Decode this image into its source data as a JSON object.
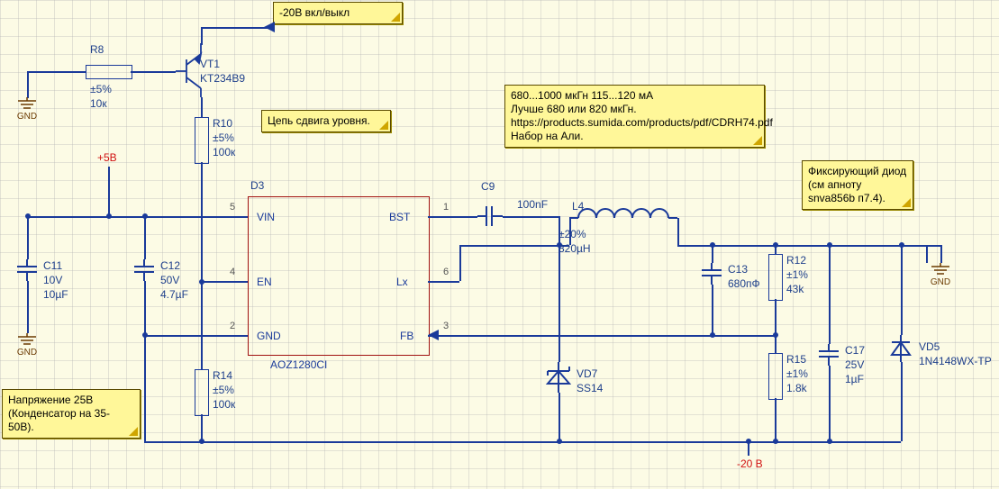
{
  "notes": {
    "input_flag": "-20В вкл/выкл",
    "level_shift": "Цепь сдвига уровня.",
    "inductor": "680...1000 мкГн  115...120 мА\nЛучше 680 или 820 мкГн.\nhttps://products.sumida.com/products/pdf/CDRH74.pdf\nНабор на Али.",
    "clamp_diode": "Фиксирующий диод (см апноту snva856b п7.4).",
    "cap_voltage": "Напряжение 25В (Конденсатор на 35-50B)."
  },
  "nets": {
    "plus5": "+5B",
    "minus20": "-20 B",
    "gnd": "GND"
  },
  "ic": {
    "ref": "D3",
    "part": "AOZ1280CI",
    "pins": {
      "vin": {
        "num": "5",
        "label": "VIN"
      },
      "en": {
        "num": "4",
        "label": "EN"
      },
      "gnd": {
        "num": "2",
        "label": "GND"
      },
      "bst": {
        "num": "1",
        "label": "BST"
      },
      "lx": {
        "num": "6",
        "label": "Lx"
      },
      "fb": {
        "num": "3",
        "label": "FB"
      }
    }
  },
  "parts": {
    "R8": {
      "ref": "R8",
      "tol": "±5%",
      "val": "10к"
    },
    "R10": {
      "ref": "R10",
      "tol": "±5%",
      "val": "100к"
    },
    "R14": {
      "ref": "R14",
      "tol": "±5%",
      "val": "100к"
    },
    "R12": {
      "ref": "R12",
      "tol": "±1%",
      "val": "43k"
    },
    "R15": {
      "ref": "R15",
      "tol": "±1%",
      "val": "1.8k"
    },
    "C9": {
      "ref": "C9",
      "val": "100nF"
    },
    "C11": {
      "ref": "C11",
      "vr": "10V",
      "val": "10µF"
    },
    "C12": {
      "ref": "C12",
      "vr": "50V",
      "val": "4.7µF"
    },
    "C13": {
      "ref": "C13",
      "val": "680пФ"
    },
    "C17": {
      "ref": "C17",
      "vr": "25V",
      "val": "1µF"
    },
    "L4": {
      "ref": "L4",
      "tol": "±20%",
      "val": "820µH"
    },
    "VT1": {
      "ref": "VT1",
      "part": "KT234B9"
    },
    "VD5": {
      "ref": "VD5",
      "part": "1N4148WX-TP"
    },
    "VD7": {
      "ref": "VD7",
      "part": "SS14"
    }
  }
}
